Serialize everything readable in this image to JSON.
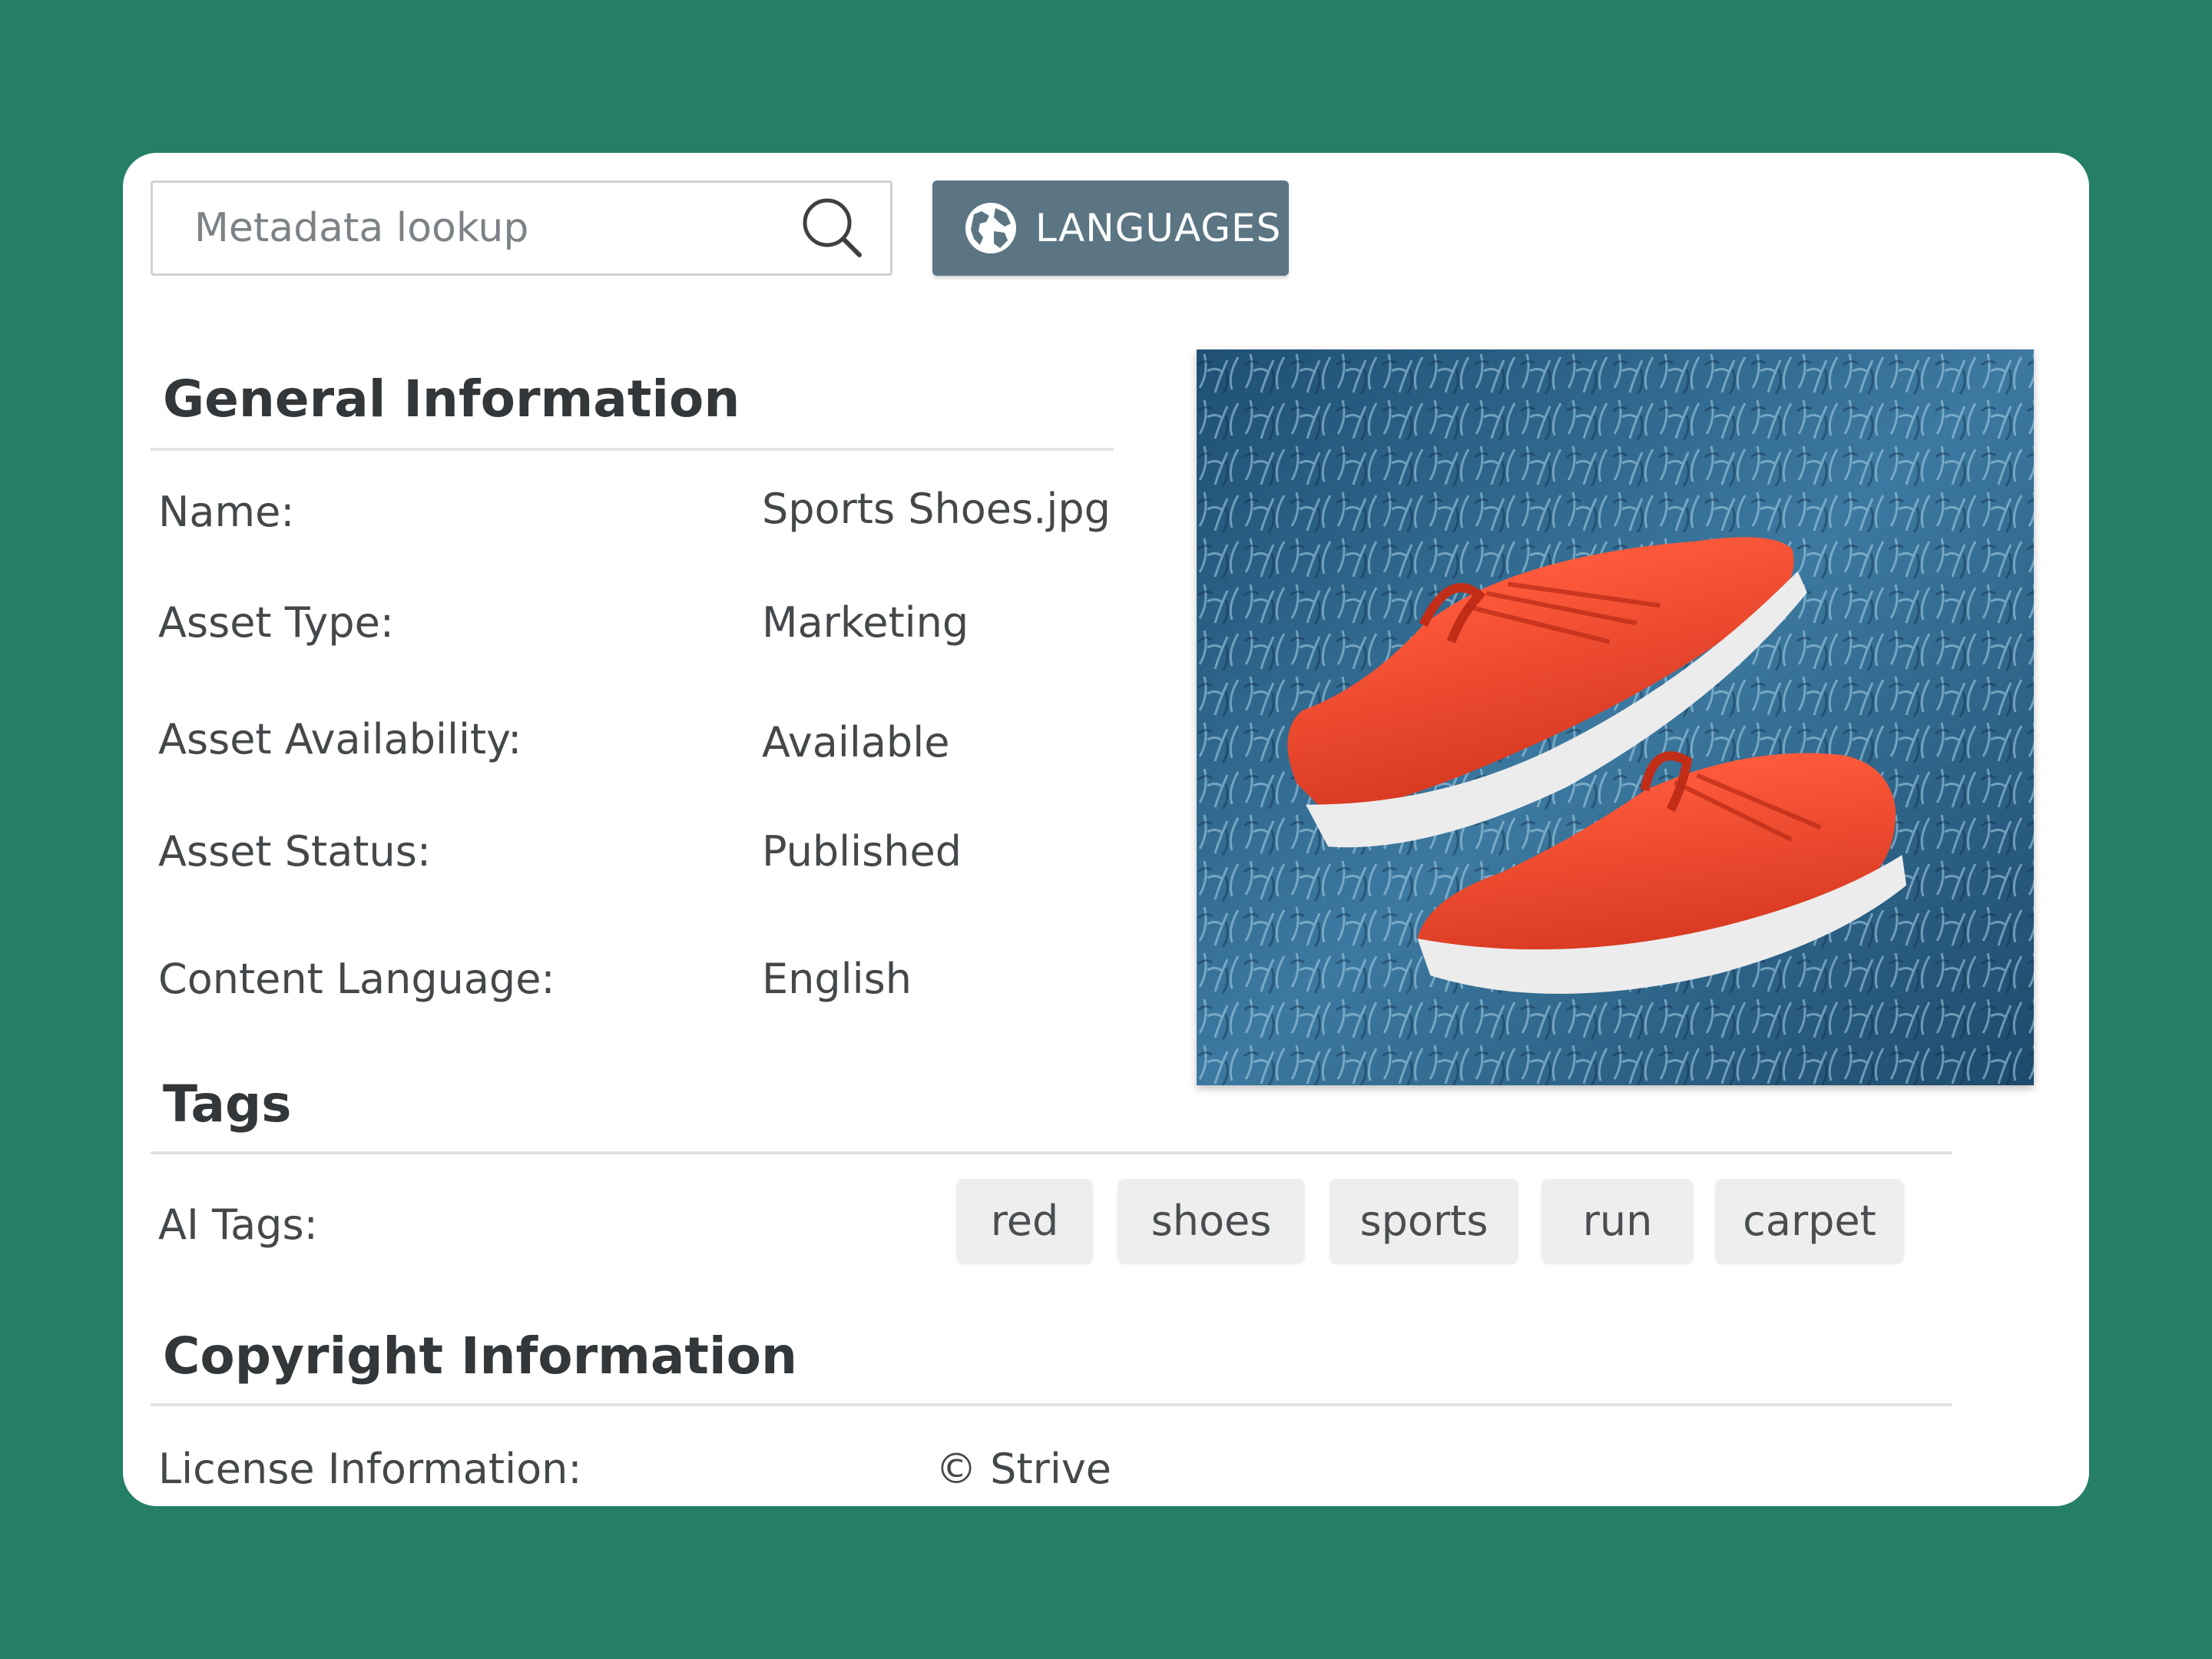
{
  "search": {
    "placeholder": "Metadata lookup"
  },
  "languages_button": {
    "label": "LANGUAGES"
  },
  "general": {
    "title": "General Information",
    "fields": [
      {
        "label": "Name:",
        "value": "Sports Shoes.jpg"
      },
      {
        "label": "Asset Type:",
        "value": "Marketing"
      },
      {
        "label": "Asset Availability:",
        "value": "Available"
      },
      {
        "label": "Asset Status:",
        "value": "Published"
      },
      {
        "label": "Content Language:",
        "value": "English"
      }
    ]
  },
  "tags": {
    "title": "Tags",
    "ai_label": "AI Tags:",
    "items": [
      "red",
      "shoes",
      "sports",
      "run",
      "carpet"
    ]
  },
  "copyright": {
    "title": "Copyright Information",
    "license_label": "License Information:",
    "license_value": "© Strive"
  },
  "preview": {
    "icon": "photo-of-red-sports-shoes-on-blue-carpet"
  },
  "colors": {
    "background": "#257f67",
    "card": "#ffffff",
    "button": "#5b7583",
    "tag_bg": "#eeeeee"
  }
}
